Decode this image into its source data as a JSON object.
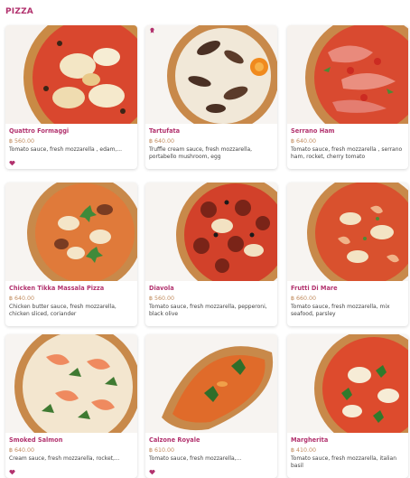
{
  "section": {
    "title": "PIZZA"
  },
  "colors": {
    "accent": "#b2326e",
    "price": "#c08a5c",
    "text": "#444444"
  },
  "items": [
    {
      "name": "Quattro Formaggi",
      "price": "฿ 560.00",
      "description": "Tomato sauce, fresh mozzarella , edam,...",
      "topping": "cheese",
      "favorite_icon": "heart-icon"
    },
    {
      "name": "Tartufata",
      "price": "฿ 640.00",
      "description": "Truffle cream sauce, fresh mozzarella, portabello mushroom, egg",
      "topping": "mushroom",
      "badge_icon": "ribbon-badge-icon"
    },
    {
      "name": "Serrano Ham",
      "price": "฿ 640.00",
      "description": "Tomato sauce, fresh mozzarella , serrano ham, rocket, cherry tomato",
      "topping": "ham"
    },
    {
      "name": "Chicken Tikka Massala Pizza",
      "price": "฿ 640.00",
      "description": "Chicken butter sauce, fresh mozzarella, chicken sliced, coriander",
      "topping": "chicken"
    },
    {
      "name": "Diavola",
      "price": "฿ 560.00",
      "description": "Tomato sauce, fresh mozzarella, pepperoni, black olive",
      "topping": "pepperoni"
    },
    {
      "name": "Frutti Di Mare",
      "price": "฿ 660.00",
      "description": "Tomato sauce, fresh mozzarella, mix seafood, parsley",
      "topping": "seafood"
    },
    {
      "name": "Smoked Salmon",
      "price": "฿ 640.00",
      "description": "Cream sauce, fresh mozzarella, rocket,...",
      "topping": "salmon",
      "favorite_icon": "heart-icon"
    },
    {
      "name": "Calzone Royale",
      "price": "฿ 610.00",
      "description": "Tomato sauce, fresh mozzarella,...",
      "topping": "calzone",
      "favorite_icon": "heart-icon"
    },
    {
      "name": "Margherita",
      "price": "฿ 410.00",
      "description": "Tomato sauce, fresh mozzarella, italian basil",
      "topping": "basil"
    }
  ]
}
